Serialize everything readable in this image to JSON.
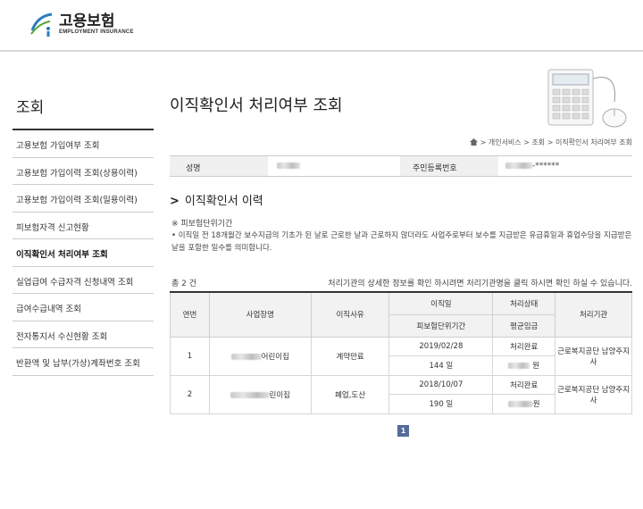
{
  "header": {
    "logo_ko": "고용보험",
    "logo_en": "EMPLOYMENT INSURANCE"
  },
  "sidebar": {
    "title": "조회",
    "items": [
      {
        "label": "고용보험 가입여부 조회"
      },
      {
        "label": "고용보험 가입이력 조회(상용이력)"
      },
      {
        "label": "고용보험 가입이력 조회(일용이력)"
      },
      {
        "label": "피보험자격 신고현황"
      },
      {
        "label": "이직확인서 처리여부 조회"
      },
      {
        "label": "실업급여 수급자격 신청내역 조회"
      },
      {
        "label": "급여수급내역 조회"
      },
      {
        "label": "전자통지서 수신현황 조회"
      },
      {
        "label": "반환액 및 납부(가상)계좌번호 조회"
      }
    ],
    "active_index": 4
  },
  "main": {
    "title": "이직확인서 처리여부 조회",
    "breadcrumb": "> 개인서비스 > 조회 > 이직확인서 처리여부 조회",
    "info": {
      "name_label": "성명",
      "rrn_label": "주민등록번호",
      "rrn_value": "-******"
    },
    "section_title": "이직확인서 이력",
    "note_title": "※ 피보험단위기간",
    "note_body": "• 이직일 전 18개월간 보수지급의 기초가 된 날로 근로한 날과 근로하지 않더라도 사업주로부터 보수를 지급받은 유급휴일과 휴업수당을 지급받은 날을 포함한 일수를 의미합니다.",
    "count_label": "총 2 건",
    "hint": "처리기관의 상세한 정보를 확인 하시려면 처리기관명을 클릭 하시면 확인 하실 수 있습니다."
  },
  "table": {
    "headers": {
      "num": "연번",
      "company": "사업장명",
      "reason": "이직사유",
      "date": "이직일",
      "period": "피보험단위기간",
      "status": "처리상태",
      "wage": "평균임금",
      "org": "처리기관"
    },
    "rows": [
      {
        "num": "1",
        "company": "어린이집",
        "reason": "계약만료",
        "date": "2019/02/28",
        "period": "144 일",
        "status": "처리완료",
        "wage": "원",
        "org": "근로복지공단 남양주지사"
      },
      {
        "num": "2",
        "company": "린이집",
        "reason": "폐업,도산",
        "date": "2018/10/07",
        "period": "190 일",
        "status": "처리완료",
        "wage": "원",
        "org": "근로복지공단 남양주지사"
      }
    ]
  },
  "pager": {
    "current": "1"
  },
  "colors": {
    "accent": "#556b9a",
    "header_bg": "#f2f2f2"
  }
}
